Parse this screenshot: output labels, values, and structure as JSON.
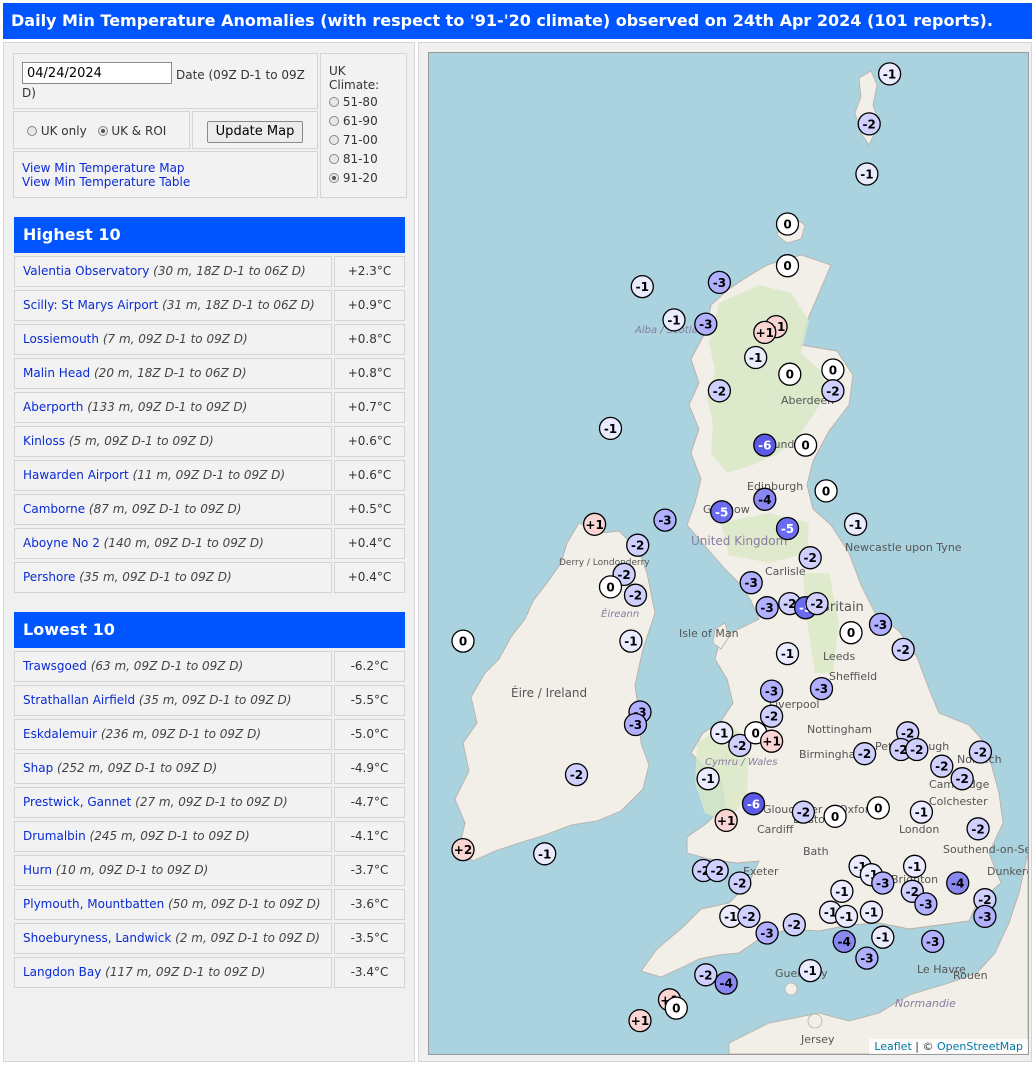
{
  "title": "Daily Min Temperature Anomalies (with respect to '91-'20 climate) observed on 24th Apr 2024 (101 reports).",
  "controls": {
    "date_value": "04/24/2024",
    "date_label": "Date (09Z D-1 to 09Z D)",
    "area_uk_only": "UK only",
    "area_uk_roi": "UK & ROI",
    "area_selected": "UK & ROI",
    "update_button": "Update Map",
    "link_map": "View Min Temperature Map",
    "link_table": "View Min Temperature Table",
    "climate_label": "UK Climate:",
    "climate_options": [
      "51-80",
      "61-90",
      "71-00",
      "81-10",
      "91-20"
    ],
    "climate_selected": "91-20"
  },
  "highest": {
    "heading": "Highest 10",
    "rows": [
      {
        "station": "Valentia Observatory",
        "meta": "(30 m, 18Z D-1 to 06Z D)",
        "value": "+2.3°C"
      },
      {
        "station": "Scilly: St Marys Airport",
        "meta": "(31 m, 18Z D-1 to 06Z D)",
        "value": "+0.9°C"
      },
      {
        "station": "Lossiemouth",
        "meta": "(7 m, 09Z D-1 to 09Z D)",
        "value": "+0.8°C"
      },
      {
        "station": "Malin Head",
        "meta": "(20 m, 18Z D-1 to 06Z D)",
        "value": "+0.8°C"
      },
      {
        "station": "Aberporth",
        "meta": "(133 m, 09Z D-1 to 09Z D)",
        "value": "+0.7°C"
      },
      {
        "station": "Kinloss",
        "meta": "(5 m, 09Z D-1 to 09Z D)",
        "value": "+0.6°C"
      },
      {
        "station": "Hawarden Airport",
        "meta": "(11 m, 09Z D-1 to 09Z D)",
        "value": "+0.6°C"
      },
      {
        "station": "Camborne",
        "meta": "(87 m, 09Z D-1 to 09Z D)",
        "value": "+0.5°C"
      },
      {
        "station": "Aboyne No 2",
        "meta": "(140 m, 09Z D-1 to 09Z D)",
        "value": "+0.4°C"
      },
      {
        "station": "Pershore",
        "meta": "(35 m, 09Z D-1 to 09Z D)",
        "value": "+0.4°C"
      }
    ]
  },
  "lowest": {
    "heading": "Lowest 10",
    "rows": [
      {
        "station": "Trawsgoed",
        "meta": "(63 m, 09Z D-1 to 09Z D)",
        "value": "-6.2°C"
      },
      {
        "station": "Strathallan Airfield",
        "meta": "(35 m, 09Z D-1 to 09Z D)",
        "value": "-5.5°C"
      },
      {
        "station": "Eskdalemuir",
        "meta": "(236 m, 09Z D-1 to 09Z D)",
        "value": "-5.0°C"
      },
      {
        "station": "Shap",
        "meta": "(252 m, 09Z D-1 to 09Z D)",
        "value": "-4.9°C"
      },
      {
        "station": "Prestwick, Gannet",
        "meta": "(27 m, 09Z D-1 to 09Z D)",
        "value": "-4.7°C"
      },
      {
        "station": "Drumalbin",
        "meta": "(245 m, 09Z D-1 to 09Z D)",
        "value": "-4.1°C"
      },
      {
        "station": "Hurn",
        "meta": "(10 m, 09Z D-1 to 09Z D)",
        "value": "-3.7°C"
      },
      {
        "station": "Plymouth, Mountbatten",
        "meta": "(50 m, 09Z D-1 to 09Z D)",
        "value": "-3.6°C"
      },
      {
        "station": "Shoeburyness, Landwick",
        "meta": "(2 m, 09Z D-1 to 09Z D)",
        "value": "-3.5°C"
      },
      {
        "station": "Langdon Bay",
        "meta": "(117 m, 09Z D-1 to 09Z D)",
        "value": "-3.4°C"
      }
    ]
  },
  "map": {
    "place_labels": [
      "Aberdeen",
      "Dundee",
      "Edinburgh",
      "Glasgow",
      "United Kingdom",
      "Newcastle upon Tyne",
      "Derry / Londonderry",
      "Carlisle",
      "Britain",
      "Isle of Man",
      "Éire / Ireland",
      "Leeds",
      "Sheffield",
      "Liverpool",
      "Nottingham",
      "Birmingham",
      "Peterborough",
      "Norwich",
      "Cambridge",
      "Colchester",
      "Gloucester",
      "Oxford",
      "London",
      "Cardiff",
      "Bristol",
      "Bath",
      "Exeter",
      "Brighton",
      "Southend-on-Sea",
      "Dunkerque",
      "Guernsey",
      "Jersey",
      "Le Havre",
      "Rouen",
      "Normandie",
      "Cymru / Wales",
      "Alba / Scotland",
      "Éireann"
    ],
    "attribution_leaflet": "Leaflet",
    "attribution_sep": " | © ",
    "attribution_osm": "OpenStreetMap",
    "colors": {
      "sea": "#aad3df",
      "land": "#f2efe9",
      "highland": "#d9e8c6",
      "positive": "#f9d6d4",
      "zero": "#ffffff",
      "minus1": "#ebebff",
      "minus2": "#d0d0ff",
      "minus3": "#b0b0ff",
      "minus4": "#8888f0",
      "minus5": "#6b6bf0",
      "minus6": "#5a5ae6"
    },
    "markers": [
      {
        "label": "-1",
        "value": -1,
        "lon": -0.85,
        "lat": 60.75
      },
      {
        "label": "-2",
        "value": -2,
        "lon": -1.3,
        "lat": 60.15
      },
      {
        "label": "-1",
        "value": -1,
        "lon": -1.35,
        "lat": 59.55
      },
      {
        "label": "0",
        "value": 0,
        "lon": -3.1,
        "lat": 58.95
      },
      {
        "label": "0",
        "value": 0,
        "lon": -3.1,
        "lat": 58.45
      },
      {
        "label": "-1",
        "value": -1,
        "lon": -6.3,
        "lat": 58.2
      },
      {
        "label": "-3",
        "value": -3,
        "lon": -4.6,
        "lat": 58.25
      },
      {
        "label": "-1",
        "value": -1,
        "lon": -5.6,
        "lat": 57.8
      },
      {
        "label": "-3",
        "value": -3,
        "lon": -4.9,
        "lat": 57.75
      },
      {
        "label": "+1",
        "value": 1,
        "lon": -3.35,
        "lat": 57.72
      },
      {
        "label": "+1",
        "value": 1,
        "lon": -3.6,
        "lat": 57.65
      },
      {
        "label": "-1",
        "value": -1,
        "lon": -3.8,
        "lat": 57.35
      },
      {
        "label": "0",
        "value": 0,
        "lon": -3.05,
        "lat": 57.15
      },
      {
        "label": "0",
        "value": 0,
        "lon": -2.1,
        "lat": 57.2
      },
      {
        "label": "-2",
        "value": -2,
        "lon": -2.1,
        "lat": 56.95
      },
      {
        "label": "-2",
        "value": -2,
        "lon": -4.6,
        "lat": 56.95
      },
      {
        "label": "-1",
        "value": -1,
        "lon": -7.0,
        "lat": 56.5
      },
      {
        "label": "-6",
        "value": -6,
        "lon": -3.6,
        "lat": 56.3
      },
      {
        "label": "0",
        "value": 0,
        "lon": -2.7,
        "lat": 56.3
      },
      {
        "label": "0",
        "value": 0,
        "lon": -2.25,
        "lat": 55.75
      },
      {
        "label": "-1",
        "value": -1,
        "lon": -1.6,
        "lat": 55.35
      },
      {
        "label": "-4",
        "value": -4,
        "lon": -3.6,
        "lat": 55.65
      },
      {
        "label": "-5",
        "value": -5,
        "lon": -4.55,
        "lat": 55.5
      },
      {
        "label": "-5",
        "value": -5,
        "lon": -3.1,
        "lat": 55.3
      },
      {
        "label": "-3",
        "value": -3,
        "lon": -5.8,
        "lat": 55.4
      },
      {
        "label": "+1",
        "value": 1,
        "lon": -7.35,
        "lat": 55.35
      },
      {
        "label": "-2",
        "value": -2,
        "lon": -6.4,
        "lat": 55.1
      },
      {
        "label": "-2",
        "value": -2,
        "lon": -2.6,
        "lat": 54.95
      },
      {
        "label": "-2",
        "value": -2,
        "lon": -6.7,
        "lat": 54.75
      },
      {
        "label": "0",
        "value": 0,
        "lon": -7.0,
        "lat": 54.6
      },
      {
        "label": "-2",
        "value": -2,
        "lon": -6.45,
        "lat": 54.5
      },
      {
        "label": "-3",
        "value": -3,
        "lon": -3.9,
        "lat": 54.65
      },
      {
        "label": "-3",
        "value": -3,
        "lon": -3.55,
        "lat": 54.35
      },
      {
        "label": "-2",
        "value": -2,
        "lon": -3.05,
        "lat": 54.4
      },
      {
        "label": "-5",
        "value": -5,
        "lon": -2.7,
        "lat": 54.35
      },
      {
        "label": "-2",
        "value": -2,
        "lon": -2.45,
        "lat": 54.4
      },
      {
        "label": "-3",
        "value": -3,
        "lon": -1.05,
        "lat": 54.15
      },
      {
        "label": "0",
        "value": 0,
        "lon": -1.7,
        "lat": 54.05
      },
      {
        "label": "-2",
        "value": -2,
        "lon": -0.55,
        "lat": 53.85
      },
      {
        "label": "0",
        "value": 0,
        "lon": -10.25,
        "lat": 53.95
      },
      {
        "label": "-1",
        "value": -1,
        "lon": -6.55,
        "lat": 53.95
      },
      {
        "label": "-1",
        "value": -1,
        "lon": -3.1,
        "lat": 53.8
      },
      {
        "label": "-3",
        "value": -3,
        "lon": -3.45,
        "lat": 53.35
      },
      {
        "label": "-3",
        "value": -3,
        "lon": -2.35,
        "lat": 53.38
      },
      {
        "label": "-2",
        "value": -2,
        "lon": -3.45,
        "lat": 53.05
      },
      {
        "label": "-3",
        "value": -3,
        "lon": -6.35,
        "lat": 53.1
      },
      {
        "label": "-3",
        "value": -3,
        "lon": -6.45,
        "lat": 52.95
      },
      {
        "label": "-1",
        "value": -1,
        "lon": -4.55,
        "lat": 52.85
      },
      {
        "label": "-2",
        "value": -2,
        "lon": -4.15,
        "lat": 52.7
      },
      {
        "label": "0",
        "value": 0,
        "lon": -3.8,
        "lat": 52.85
      },
      {
        "label": "+1",
        "value": 1,
        "lon": -3.45,
        "lat": 52.75
      },
      {
        "label": "-2",
        "value": -2,
        "lon": -1.4,
        "lat": 52.6
      },
      {
        "label": "-2",
        "value": -2,
        "lon": -0.45,
        "lat": 52.85
      },
      {
        "label": "-2",
        "value": -2,
        "lon": -0.6,
        "lat": 52.65
      },
      {
        "label": "-2",
        "value": -2,
        "lon": -0.25,
        "lat": 52.65
      },
      {
        "label": "-2",
        "value": -2,
        "lon": 0.3,
        "lat": 52.45
      },
      {
        "label": "-2",
        "value": -2,
        "lon": 1.15,
        "lat": 52.62
      },
      {
        "label": "-2",
        "value": -2,
        "lon": 0.75,
        "lat": 52.3
      },
      {
        "label": "-1",
        "value": -1,
        "lon": -4.85,
        "lat": 52.3
      },
      {
        "label": "-2",
        "value": -2,
        "lon": -7.75,
        "lat": 52.35
      },
      {
        "label": "-6",
        "value": -6,
        "lon": -3.85,
        "lat": 52.0
      },
      {
        "label": "-2",
        "value": -2,
        "lon": -2.75,
        "lat": 51.9
      },
      {
        "label": "0",
        "value": 0,
        "lon": -2.05,
        "lat": 51.85
      },
      {
        "label": "0",
        "value": 0,
        "lon": -1.1,
        "lat": 51.95
      },
      {
        "label": "-1",
        "value": -1,
        "lon": -0.15,
        "lat": 51.9
      },
      {
        "label": "-2",
        "value": -2,
        "lon": 1.1,
        "lat": 51.7
      },
      {
        "label": "+1",
        "value": 1,
        "lon": -4.45,
        "lat": 51.8
      },
      {
        "label": "+2",
        "value": 2,
        "lon": -10.25,
        "lat": 51.45
      },
      {
        "label": "-1",
        "value": -1,
        "lon": -8.45,
        "lat": 51.4
      },
      {
        "label": "-2",
        "value": -2,
        "lon": -4.95,
        "lat": 51.2
      },
      {
        "label": "-2",
        "value": -2,
        "lon": -4.65,
        "lat": 51.2
      },
      {
        "label": "-2",
        "value": -2,
        "lon": -4.15,
        "lat": 51.05
      },
      {
        "label": "-1",
        "value": -1,
        "lon": -1.5,
        "lat": 51.25
      },
      {
        "label": "-1",
        "value": -1,
        "lon": -1.25,
        "lat": 51.15
      },
      {
        "label": "-1",
        "value": -1,
        "lon": -0.3,
        "lat": 51.25
      },
      {
        "label": "-3",
        "value": -3,
        "lon": -1.0,
        "lat": 51.05
      },
      {
        "label": "-1",
        "value": -1,
        "lon": -1.9,
        "lat": 50.95
      },
      {
        "label": "-2",
        "value": -2,
        "lon": -0.35,
        "lat": 50.95
      },
      {
        "label": "-3",
        "value": -3,
        "lon": -0.05,
        "lat": 50.8
      },
      {
        "label": "-4",
        "value": -4,
        "lon": 0.65,
        "lat": 51.05
      },
      {
        "label": "-2",
        "value": -2,
        "lon": 1.25,
        "lat": 50.85
      },
      {
        "label": "-3",
        "value": -3,
        "lon": 1.25,
        "lat": 50.65
      },
      {
        "label": "-1",
        "value": -1,
        "lon": -4.35,
        "lat": 50.65
      },
      {
        "label": "-2",
        "value": -2,
        "lon": -3.95,
        "lat": 50.65
      },
      {
        "label": "-3",
        "value": -3,
        "lon": -3.55,
        "lat": 50.45
      },
      {
        "label": "-2",
        "value": -2,
        "lon": -2.95,
        "lat": 50.55
      },
      {
        "label": "-1",
        "value": -1,
        "lon": -2.15,
        "lat": 50.7
      },
      {
        "label": "-1",
        "value": -1,
        "lon": -1.8,
        "lat": 50.65
      },
      {
        "label": "-1",
        "value": -1,
        "lon": -1.25,
        "lat": 50.7
      },
      {
        "label": "-1",
        "value": -1,
        "lon": -1.0,
        "lat": 50.4
      },
      {
        "label": "-4",
        "value": -4,
        "lon": -1.85,
        "lat": 50.35
      },
      {
        "label": "-3",
        "value": -3,
        "lon": -1.35,
        "lat": 50.15
      },
      {
        "label": "-1",
        "value": -1,
        "lon": -2.6,
        "lat": 50.0
      },
      {
        "label": "-3",
        "value": -3,
        "lon": 0.1,
        "lat": 50.35
      },
      {
        "label": "-2",
        "value": -2,
        "lon": -4.9,
        "lat": 49.95
      },
      {
        "label": "-4",
        "value": -4,
        "lon": -4.45,
        "lat": 49.85
      },
      {
        "label": "+1",
        "value": 1,
        "lon": -5.7,
        "lat": 49.65
      },
      {
        "label": "0",
        "value": 0,
        "lon": -5.55,
        "lat": 49.55
      },
      {
        "label": "+1",
        "value": 1,
        "lon": -6.35,
        "lat": 49.4
      }
    ]
  }
}
